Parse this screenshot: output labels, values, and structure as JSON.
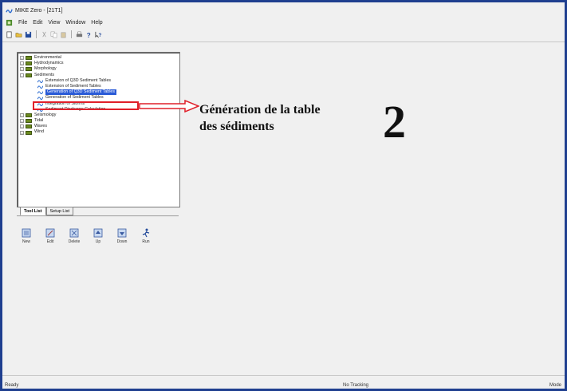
{
  "window": {
    "title": "MIKE Zero - [21T1]"
  },
  "menu": [
    "File",
    "Edit",
    "View",
    "Window",
    "Help"
  ],
  "tree": {
    "items": [
      {
        "label": "Environmental",
        "expanded": false
      },
      {
        "label": "Hydrodynamics",
        "expanded": false
      },
      {
        "label": "Morphology",
        "expanded": false
      },
      {
        "label": "Sediments",
        "expanded": true
      }
    ],
    "sediment_children": [
      "Extension of Q3D Sediment Tables",
      "Extension of Sediment Tables",
      "Generation of Q3D Sediment Tables",
      "Generation of Sediment Tables",
      "Integration of Storms",
      "Sediment Discharge Calculation"
    ],
    "selected": "Generation of Q3D Sediment Tables",
    "after": [
      "Seismology",
      "Tidal",
      "Waves",
      "Wind"
    ]
  },
  "annotation": {
    "line1": "Génération de la table",
    "line2": "des sédiments",
    "number": "2"
  },
  "tabs": {
    "tool_list": "Tool List",
    "setup_list": "Setup List"
  },
  "buttons": {
    "new": "New",
    "edit": "Edit",
    "delete": "Delete",
    "up": "Up",
    "down": "Down",
    "run": "Run"
  },
  "status": {
    "left": "Ready",
    "middle": "No Tracking",
    "right": "Mode"
  },
  "colors": {
    "accent": "#e0202a",
    "selection": "#2a5bd7",
    "frame": "#1f3f8f"
  }
}
